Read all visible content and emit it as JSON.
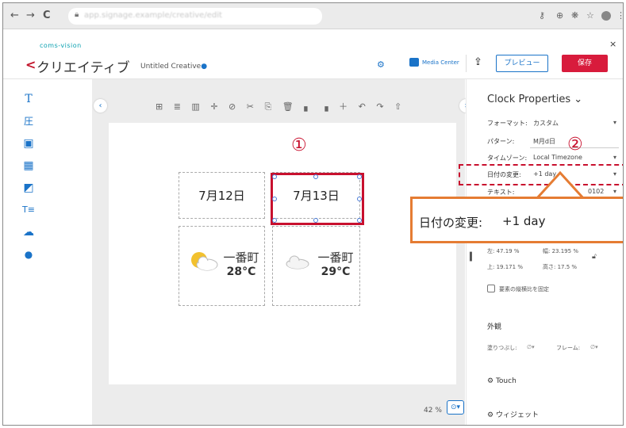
{
  "browser": {
    "back": "←",
    "forward": "→",
    "reload": "C",
    "url": "app.signage.example/creative/edit",
    "right_icons": [
      "key-icon",
      "zoom-icon",
      "extension-icon",
      "star-icon",
      "profile-icon",
      "menu-icon"
    ]
  },
  "header": {
    "logo": "coms-vision",
    "back_arrow": "<",
    "title": "クリエイティブ",
    "creative_name": "Untitled Creative",
    "unsaved_dot": "●",
    "media_center": "Media Center",
    "preview": "プレビュー",
    "save": "保存",
    "close": "×"
  },
  "toolbox": {
    "items": [
      {
        "icon": "text-tool-icon",
        "glyph": "T"
      },
      {
        "icon": "text-block-icon",
        "glyph": "圧"
      },
      {
        "icon": "image-icon",
        "glyph": "▣"
      },
      {
        "icon": "video-icon",
        "glyph": "▦"
      },
      {
        "icon": "slides-icon",
        "glyph": "◩"
      },
      {
        "icon": "ticker-icon",
        "glyph": "T≡"
      },
      {
        "icon": "weather-icon",
        "glyph": "☁"
      },
      {
        "icon": "clock-icon",
        "glyph": "●"
      }
    ]
  },
  "editor": {
    "toolstrip": "⊞ ≣ ▥ ✛ ⊘ ✂ ⎘ 🗑 ▖ ▗ ＋ ↶ ↷ ⇧",
    "collapse_left": "‹",
    "collapse_right": "›",
    "cells": {
      "date1": "7月12日",
      "date2": "7月13日",
      "wx1_loc": "一番町",
      "wx1_temp": "28°C",
      "wx2_loc": "一番町",
      "wx2_temp": "29°C"
    },
    "zoom": "42 %",
    "zoom_btn": "⊙▾",
    "marker1": "①"
  },
  "panel": {
    "title": "Clock Properties",
    "title_caret": "⌄",
    "format_label": "フォーマット:",
    "format_value": "カスタム",
    "pattern_label": "パターン:",
    "pattern_value": "M月d日",
    "timezone_label": "タイムゾーン:",
    "timezone_value": "Local Timezone",
    "datechange_label": "日付の変更:",
    "datechange_value": "+1 day",
    "text_label": "テキスト:",
    "text_value": "0102",
    "marker2": "②",
    "left_label": "左:",
    "left_value": "47.19",
    "width_label": "幅:",
    "width_value": "23.195",
    "top_label": "上:",
    "top_value": "19.171",
    "height_label": "高さ:",
    "height_value": "17.5",
    "pct": "%",
    "aspect_label": "要素の縦横比を固定",
    "appearance": "外観",
    "fill_label": "塗りつぶし:",
    "frame_label": "フレーム:",
    "none_glyph": "∅▾",
    "touch": "Touch",
    "widget": "ウィジェット"
  },
  "callout": {
    "label": "日付の変更:",
    "value": "+1 day"
  }
}
